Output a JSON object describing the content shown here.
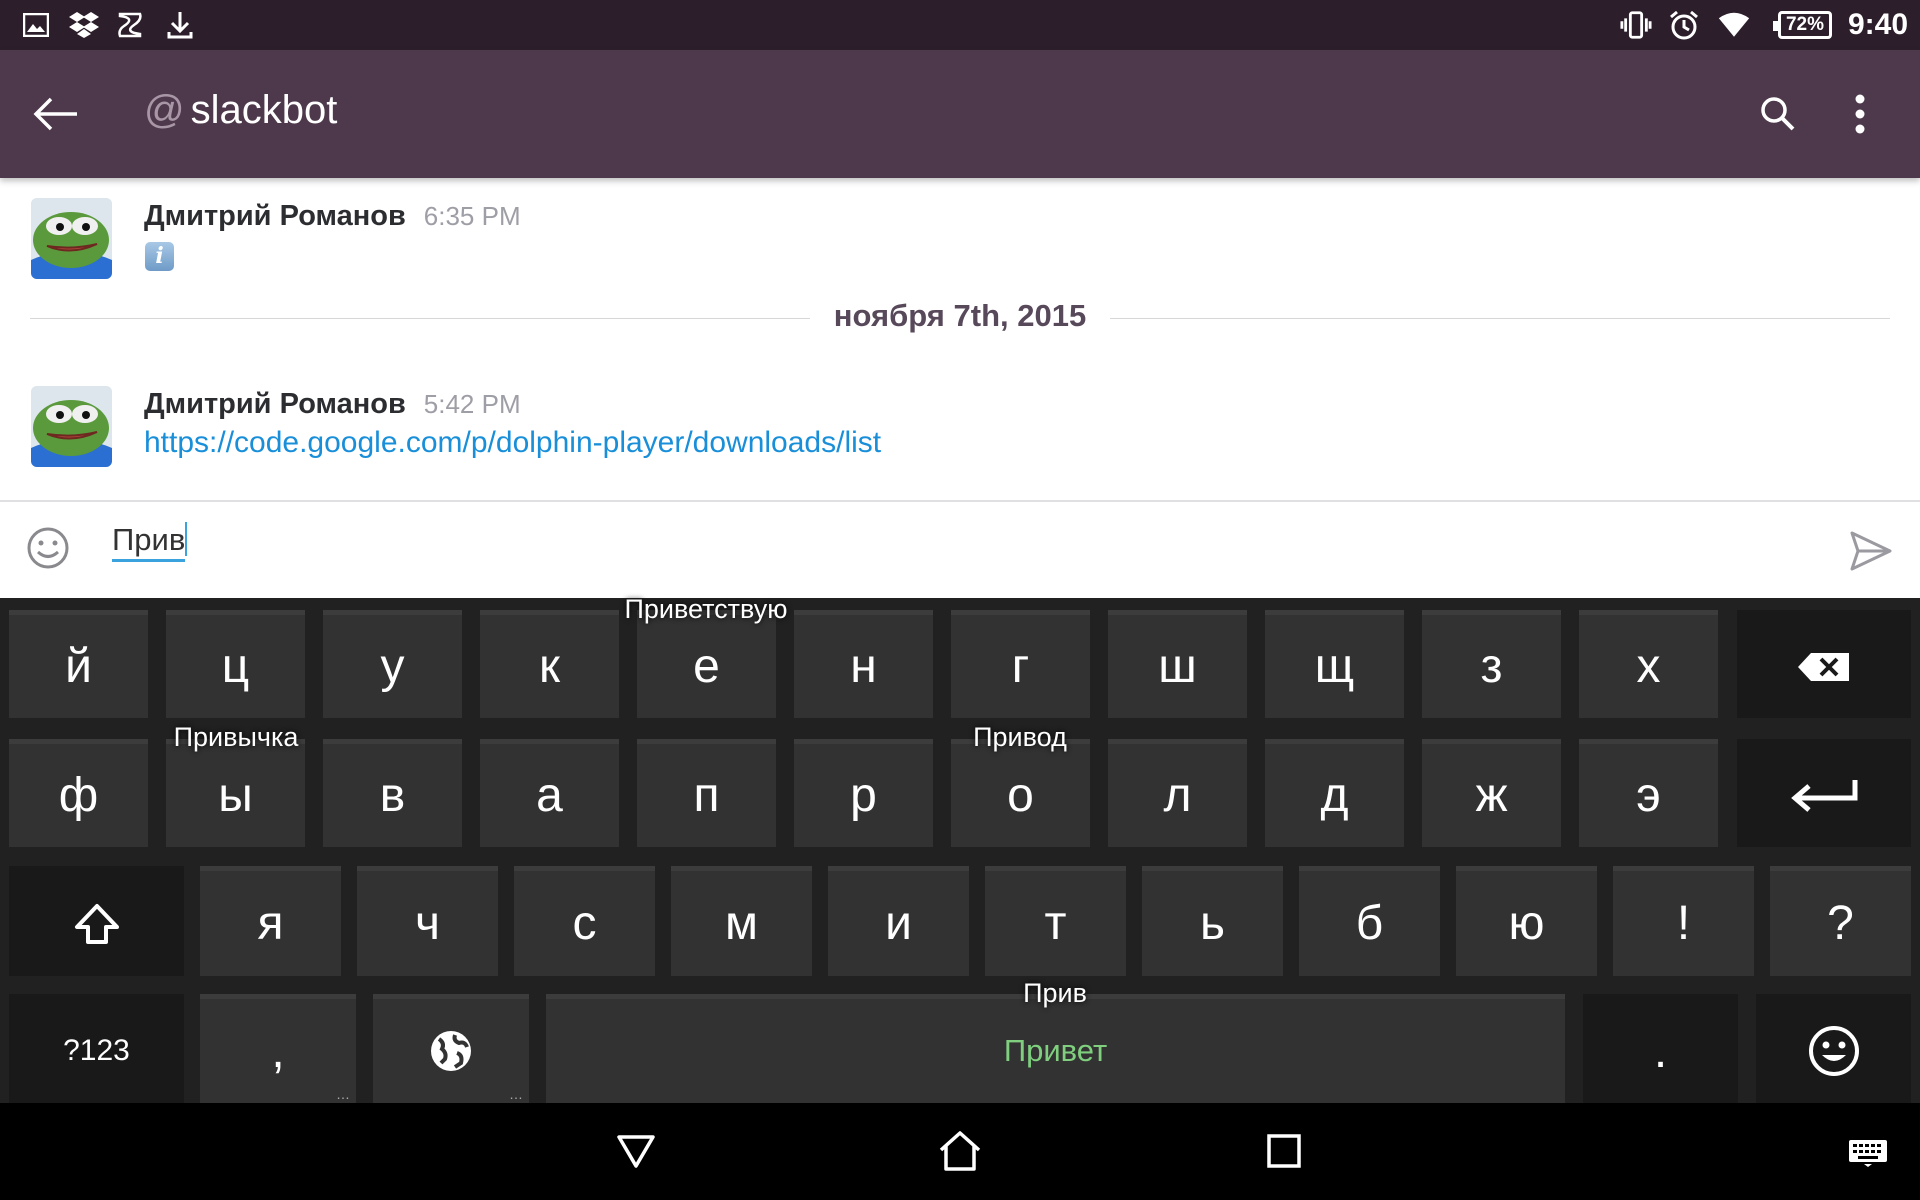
{
  "status_bar": {
    "battery": "72%",
    "time": "9:40",
    "left_icons": [
      "image-icon",
      "dropbox-icon",
      "slack-s-icon",
      "download-icon"
    ],
    "right_icons": [
      "vibrate-icon",
      "alarm-icon",
      "wifi-icon",
      "battery-icon"
    ]
  },
  "app_bar": {
    "at_symbol": "@",
    "channel_name": "slackbot",
    "back_icon": "arrow-back-icon",
    "search_icon": "search-icon",
    "menu_icon": "more-vert-icon",
    "background": "#4d394b"
  },
  "messages": [
    {
      "author": "Дмитрий Романов",
      "time": "6:35 PM",
      "content_type": "emoji",
      "emoji": "i"
    },
    {
      "author": "Дмитрий Романов",
      "time": "5:42 PM",
      "content_type": "link",
      "text": "https://code.google.com/p/dolphin-player/downloads/list"
    }
  ],
  "day_divider": "ноября 7th, 2015",
  "composer": {
    "value": "Прив",
    "emoji_icon": "smiley-icon",
    "send_icon": "send-icon"
  },
  "keyboard": {
    "row1": [
      "й",
      "ц",
      "у",
      "к",
      "е",
      "н",
      "г",
      "ш",
      "щ",
      "з",
      "х"
    ],
    "row2": [
      "ф",
      "ы",
      "в",
      "а",
      "п",
      "р",
      "о",
      "л",
      "д",
      "ж",
      "э"
    ],
    "row3": [
      "я",
      "ч",
      "с",
      "м",
      "и",
      "т",
      "ь",
      "б",
      "ю",
      "!",
      "?"
    ],
    "symbols_key": "?123",
    "comma_key": ",",
    "period_key": ".",
    "space_suggestion": "Привет",
    "suggestions": {
      "top": "Приветствую",
      "left": "Привычка",
      "right": "Привод",
      "space_above": "Прив"
    }
  },
  "nav_bar": {
    "icons": [
      "back-triangle-icon",
      "home-icon",
      "recents-icon",
      "keyboard-icon"
    ]
  }
}
